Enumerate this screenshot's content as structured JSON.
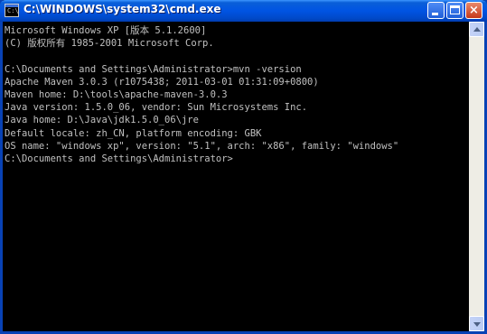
{
  "window": {
    "title": "C:\\WINDOWS\\system32\\cmd.exe",
    "icon": "cmd-icon",
    "icon_text": "C:\\",
    "buttons": {
      "minimize": "minimize-icon",
      "maximize": "maximize-icon",
      "close": "close-icon",
      "close_glyph": "×"
    }
  },
  "console": {
    "lines": [
      "Microsoft Windows XP [版本 5.1.2600]",
      "(C) 版权所有 1985-2001 Microsoft Corp.",
      "",
      "C:\\Documents and Settings\\Administrator>mvn -version",
      "Apache Maven 3.0.3 (r1075438; 2011-03-01 01:31:09+0800)",
      "Maven home: D:\\tools\\apache-maven-3.0.3",
      "Java version: 1.5.0_06, vendor: Sun Microsystems Inc.",
      "Java home: D:\\Java\\jdk1.5.0_06\\jre",
      "Default locale: zh_CN, platform encoding: GBK",
      "OS name: \"windows xp\", version: \"5.1\", arch: \"x86\", family: \"windows\"",
      "C:\\Documents and Settings\\Administrator>"
    ]
  },
  "colors": {
    "console_bg": "#000000",
    "console_text": "#c0c0c0",
    "titlebar": "#0054e3"
  }
}
